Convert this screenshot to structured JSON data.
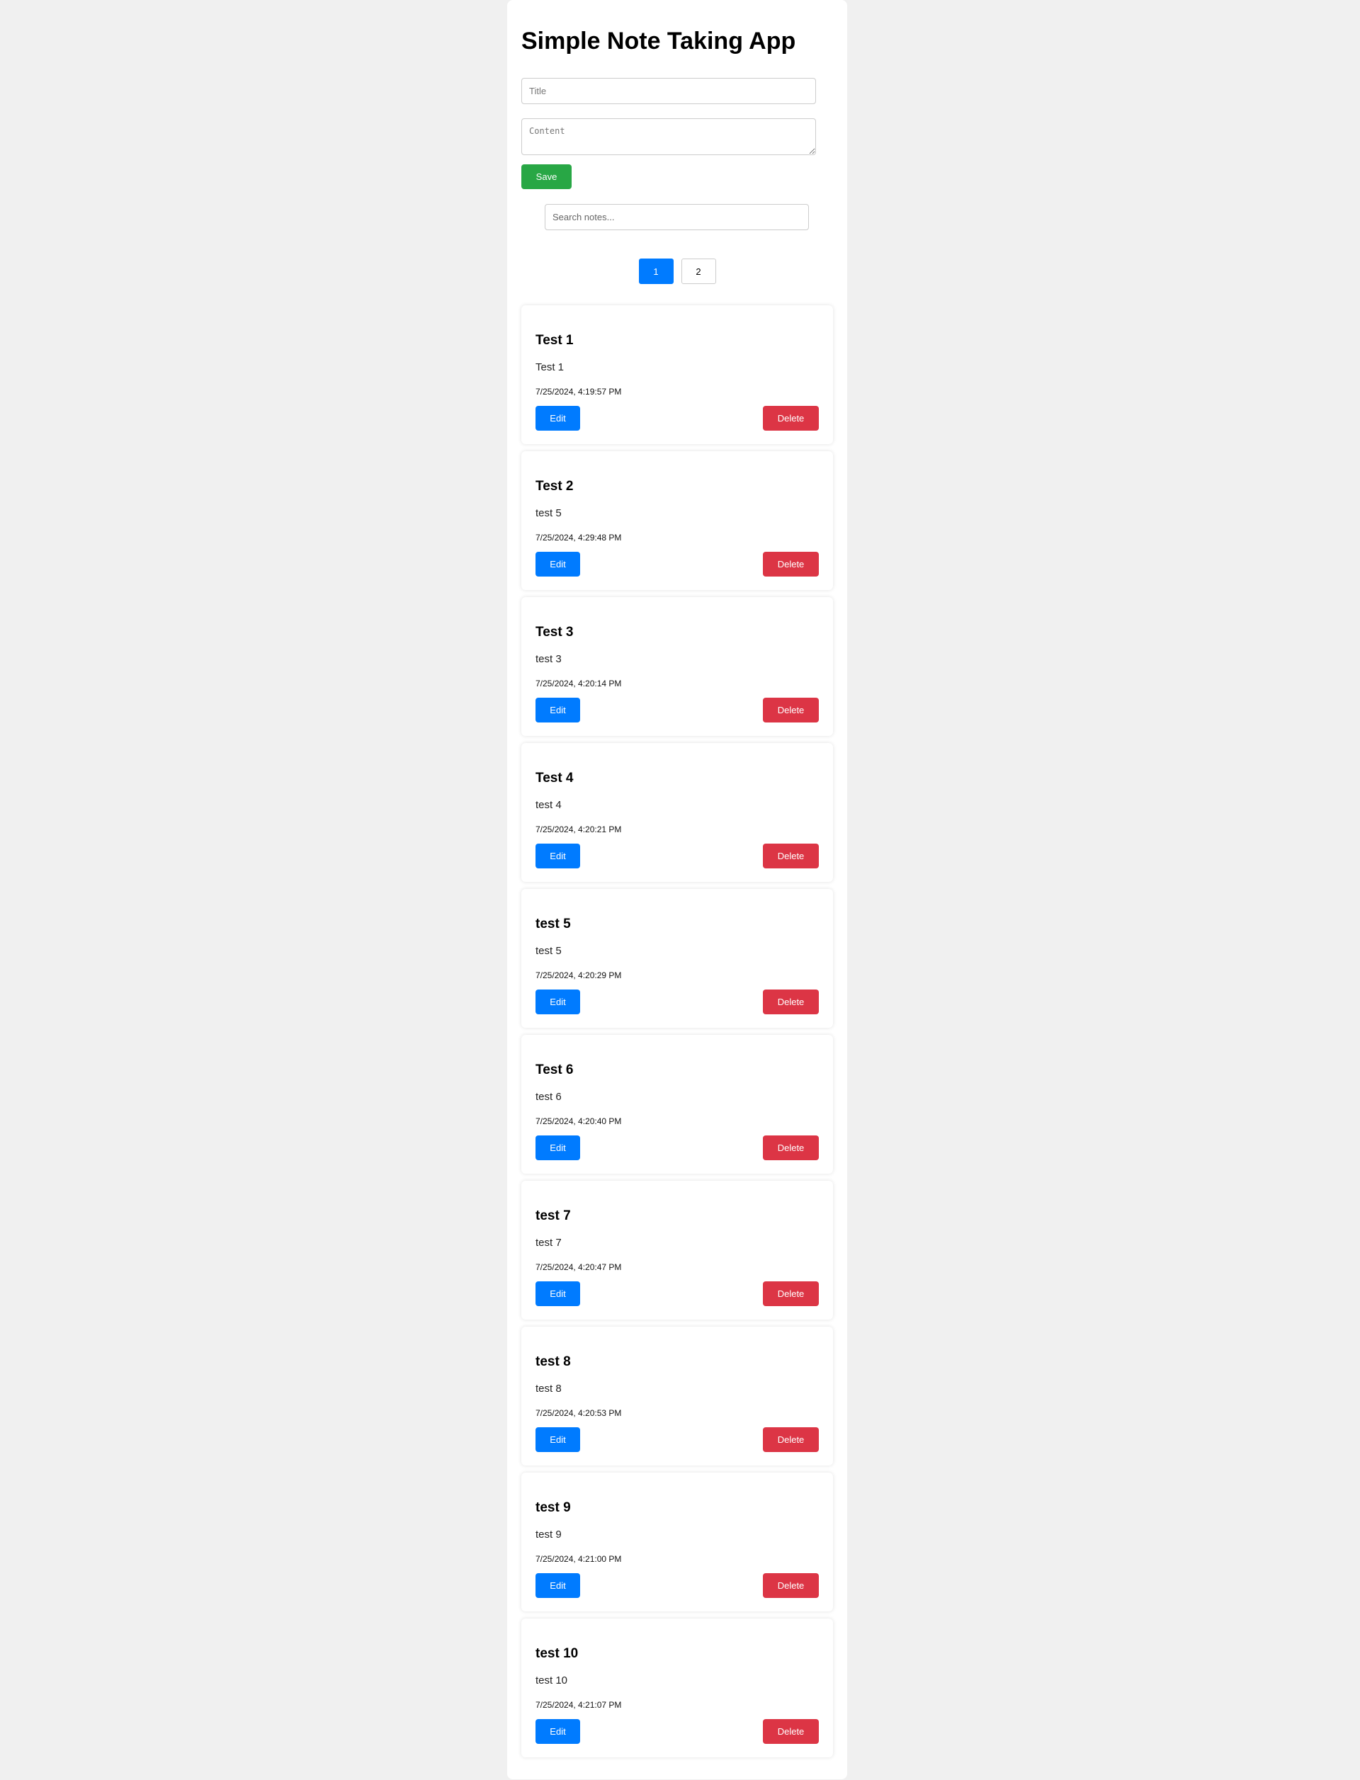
{
  "app": {
    "title": "Simple Note Taking App"
  },
  "form": {
    "title_placeholder": "Title",
    "content_placeholder": "Content",
    "save_label": "Save"
  },
  "search": {
    "placeholder": "Search notes..."
  },
  "pagination": {
    "current": 1,
    "pages": [
      "1",
      "2"
    ]
  },
  "colors": {
    "save": "#28a745",
    "edit": "#007bff",
    "delete": "#dc3545",
    "active_page": "#007bff",
    "background": "#f0f0f0"
  },
  "notes": [
    {
      "title": "Test 1",
      "content": "Test 1",
      "date": "7/25/2024, 4:19:57 PM",
      "edit_label": "Edit",
      "delete_label": "Delete"
    },
    {
      "title": "Test 2",
      "content": "test 5",
      "date": "7/25/2024, 4:29:48 PM",
      "edit_label": "Edit",
      "delete_label": "Delete"
    },
    {
      "title": "Test 3",
      "content": "test 3",
      "date": "7/25/2024, 4:20:14 PM",
      "edit_label": "Edit",
      "delete_label": "Delete"
    },
    {
      "title": "Test 4",
      "content": "test 4",
      "date": "7/25/2024, 4:20:21 PM",
      "edit_label": "Edit",
      "delete_label": "Delete"
    },
    {
      "title": "test 5",
      "content": "test 5",
      "date": "7/25/2024, 4:20:29 PM",
      "edit_label": "Edit",
      "delete_label": "Delete"
    },
    {
      "title": "Test 6",
      "content": "test 6",
      "date": "7/25/2024, 4:20:40 PM",
      "edit_label": "Edit",
      "delete_label": "Delete"
    },
    {
      "title": "test 7",
      "content": "test 7",
      "date": "7/25/2024, 4:20:47 PM",
      "edit_label": "Edit",
      "delete_label": "Delete"
    },
    {
      "title": "test 8",
      "content": "test 8",
      "date": "7/25/2024, 4:20:53 PM",
      "edit_label": "Edit",
      "delete_label": "Delete"
    },
    {
      "title": "test 9",
      "content": "test 9",
      "date": "7/25/2024, 4:21:00 PM",
      "edit_label": "Edit",
      "delete_label": "Delete"
    },
    {
      "title": "test 10",
      "content": "test 10",
      "date": "7/25/2024, 4:21:07 PM",
      "edit_label": "Edit",
      "delete_label": "Delete"
    }
  ]
}
